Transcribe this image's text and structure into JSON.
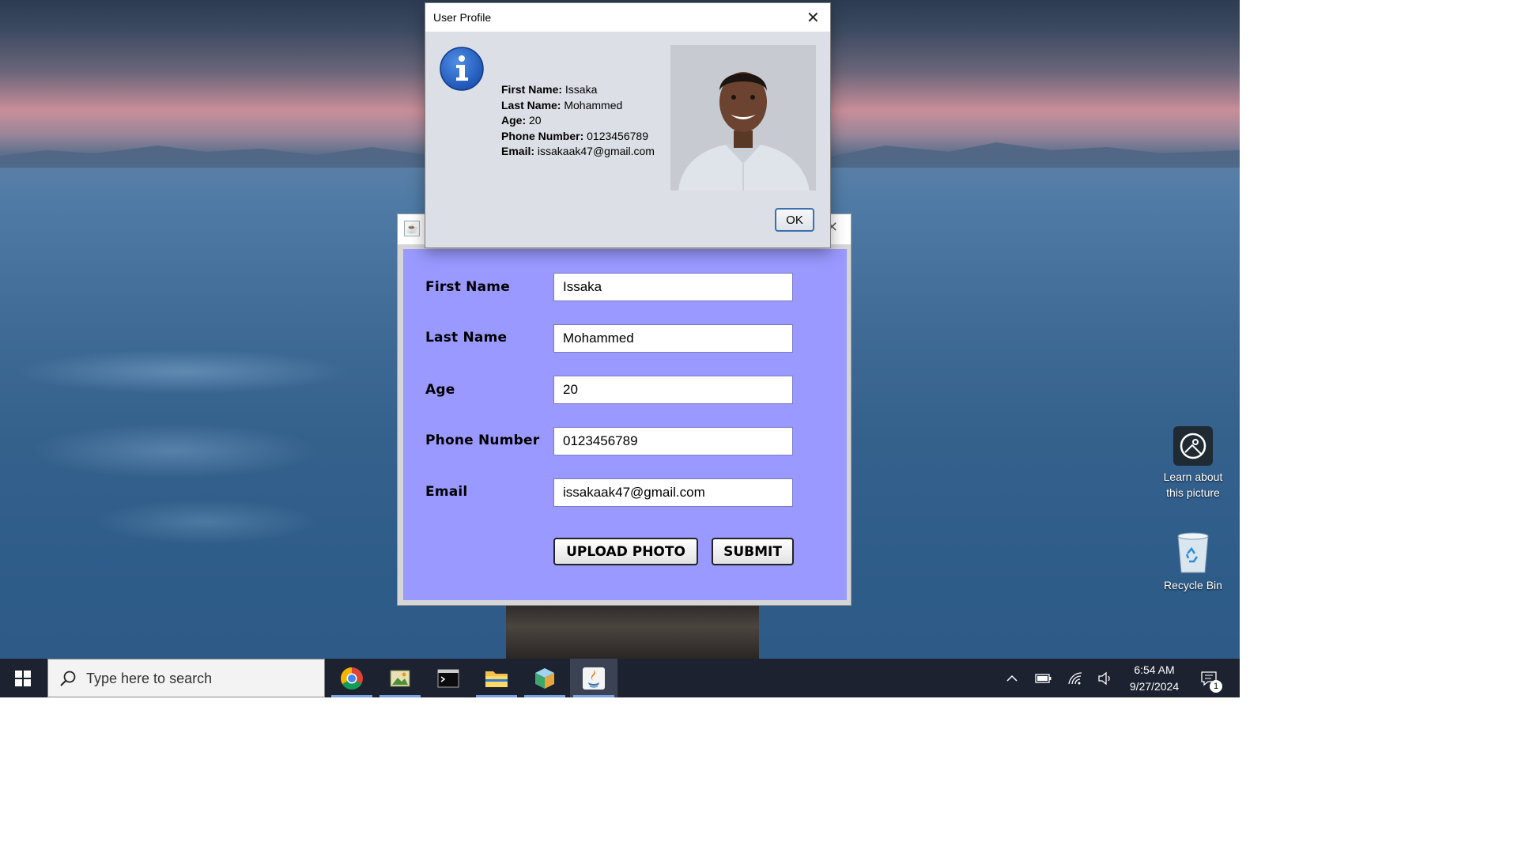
{
  "desktop": {
    "icons": [
      {
        "label_line1": "Learn about",
        "label_line2": "this picture",
        "icon": "camera-circle-icon"
      },
      {
        "label": "Recycle Bin",
        "icon": "recycle-bin-icon"
      }
    ]
  },
  "dialog": {
    "title": "User Profile",
    "icon": "info-icon",
    "fields": [
      {
        "label": "First Name:",
        "value": "Issaka"
      },
      {
        "label": "Last Name:",
        "value": "Mohammed"
      },
      {
        "label": "Age:",
        "value": "20"
      },
      {
        "label": "Phone Number:",
        "value": "0123456789"
      },
      {
        "label": "Email:",
        "value": "issakaak47@gmail.com"
      }
    ],
    "ok_label": "OK"
  },
  "form": {
    "panel_color": "#9999ff",
    "fields": [
      {
        "label": "First Name",
        "value": "Issaka"
      },
      {
        "label": "Last Name",
        "value": "Mohammed"
      },
      {
        "label": "Age",
        "value": "20"
      },
      {
        "label": "Phone Number",
        "value": "0123456789"
      },
      {
        "label": "Email",
        "value": "issakaak47@gmail.com"
      }
    ],
    "upload_label": "UPLOAD PHOTO",
    "submit_label": "SUBMIT"
  },
  "taskbar": {
    "search_placeholder": "Type here to search",
    "apps": [
      "chrome-icon",
      "image-editor-icon",
      "terminal-icon",
      "file-explorer-icon",
      "cube-app-icon",
      "java-icon"
    ],
    "time": "6:54 AM",
    "date": "9/27/2024",
    "notification_count": "1"
  }
}
